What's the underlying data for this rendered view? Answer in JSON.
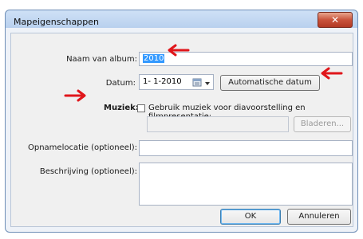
{
  "window": {
    "title": "Mapeigenschappen",
    "close_glyph": "✕"
  },
  "form": {
    "album_name_label": "Naam van album:",
    "album_name_value": "2010",
    "date_label": "Datum:",
    "date_value": "1- 1-2010",
    "auto_date_button": "Automatische datum",
    "music_label": "Muziek:",
    "music_checkbox_label": "Gebruik muziek voor diavoorstelling en filmpresentatie:",
    "browse_button": "Bladeren...",
    "location_label": "Opnamelocatie (optioneel):",
    "location_value": "",
    "description_label": "Beschrijving (optioneel):",
    "description_value": ""
  },
  "footer": {
    "ok_button": "OK",
    "cancel_button": "Annuleren"
  },
  "icons": {
    "calendar": "calendar-icon",
    "dropdown": "chevron-down-icon",
    "annotation_arrows": "red-arrow-icon"
  },
  "colors": {
    "annotation_red": "#e0161b",
    "selection_blue": "#3399ff",
    "close_red": "#c9533b"
  }
}
